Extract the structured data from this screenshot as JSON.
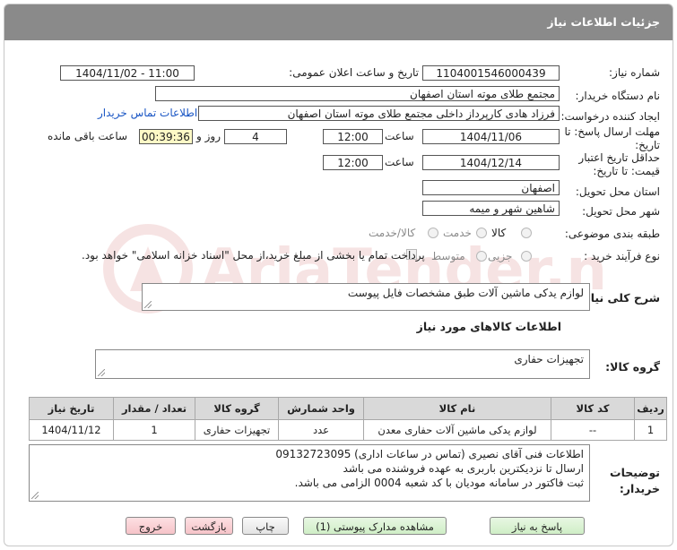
{
  "header": {
    "title": "جزئیات اطلاعات نیاز"
  },
  "fields": {
    "need_number_label": "شماره نیاز:",
    "need_number": "1104001546000439",
    "announce_label": "تاریخ و ساعت اعلان عمومی:",
    "announce_value": "1404/11/02 - 11:00",
    "buyer_org_label": "نام دستگاه خریدار:",
    "buyer_org": "مجتمع طلای موته استان اصفهان",
    "creator_label": "ایجاد کننده درخواست:",
    "creator": "فرزاد هادی کارپرداز داخلی مجتمع طلای موته استان اصفهان",
    "contact_link": "اطلاعات تماس خریدار",
    "reply_deadline_label": "مهلت ارسال پاسخ: تا تاریخ:",
    "reply_date": "1404/11/06",
    "time_label": "ساعت",
    "reply_time": "12:00",
    "days_value": "4",
    "days_label": "روز و",
    "remaining_value": "00:39:36",
    "remaining_label": "ساعت باقی مانده",
    "price_validity_label": "حداقل تاریخ اعتبار قیمت: تا تاریخ:",
    "validity_date": "1404/12/14",
    "validity_time": "12:00",
    "province_label": "استان محل تحویل:",
    "province": "اصفهان",
    "city_label": "شهر محل تحویل:",
    "city": "شاهین شهر و میمه",
    "category_label": "طبقه بندی موضوعی:",
    "category_options": [
      "کالا",
      "خدمت",
      "کالا/خدمت"
    ],
    "process_label": "نوع فرآیند خرید :",
    "process_options": [
      "جزیی",
      "متوسط"
    ],
    "treasury_note": "پرداخت تمام یا بخشی از مبلغ خرید،از محل \"اسناد خزانه اسلامی\" خواهد بود."
  },
  "description": {
    "label": "شرح کلی نیاز:",
    "text": "لوازم یدکی ماشین آلات طبق مشخصات فایل پیوست"
  },
  "goods_section": {
    "title": "اطلاعات کالاهای مورد نیاز",
    "group_label": "گروه کالا:",
    "group_value": "تجهیزات حفاری"
  },
  "table": {
    "headers": [
      "ردیف",
      "کد کالا",
      "نام کالا",
      "واحد شمارش",
      "گروه کالا",
      "تعداد / مقدار",
      "تاریخ نیاز"
    ],
    "rows": [
      [
        "1",
        "--",
        "لوازم یدکی ماشین آلات حفاری معدن",
        "عدد",
        "تجهیزات حفاری",
        "1",
        "1404/11/12"
      ]
    ]
  },
  "buyer_notes": {
    "label": "توضیحات خریدار:",
    "lines": [
      "اطلاعات فنی آقای نصیری (تماس در ساعات اداری) 09132723095",
      "ارسال تا نزدیکترین باربری به عهده فروشنده می باشد",
      "ثبت فاکتور در سامانه مودیان با کد شعبه 0004 الزامی می باشد."
    ]
  },
  "buttons": {
    "reply": "پاسخ به نیاز",
    "attachments": "مشاهده مدارک پیوستی (1)",
    "print": "چاپ",
    "back": "بازگشت",
    "exit": "خروج"
  },
  "colors": {
    "titlebar": "#8a8a8a",
    "link": "#1a56c4",
    "highlight": "#fdf9c6",
    "exit_button": "#f6c3c8",
    "green_button": "#cfeec6"
  }
}
